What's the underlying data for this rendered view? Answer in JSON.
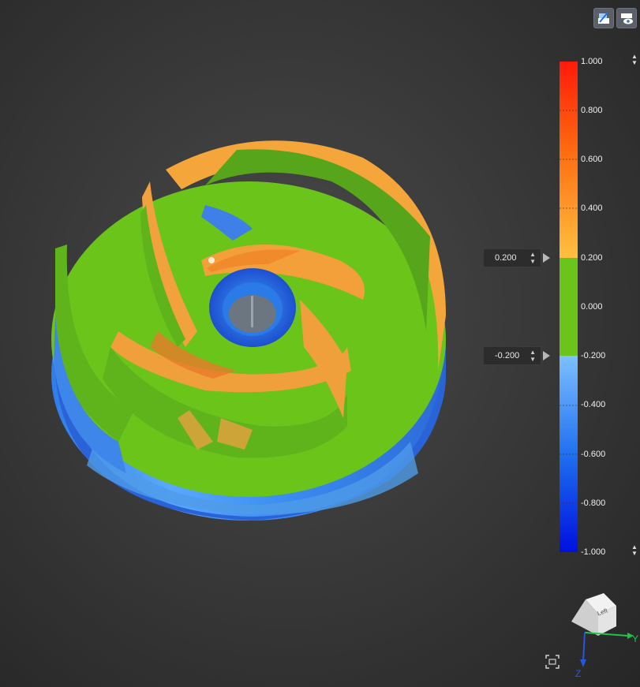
{
  "toolbar": {
    "buttons": [
      {
        "name": "section-view-button",
        "icon": "section-icon"
      },
      {
        "name": "visibility-button",
        "icon": "eye-icon"
      }
    ]
  },
  "colorbar": {
    "max": "1.000",
    "min": "-1.000",
    "ticks": [
      "1.000",
      "0.800",
      "0.600",
      "0.400",
      "0.200",
      "0.000",
      "-0.200",
      "-0.400",
      "-0.600",
      "-0.800",
      "-1.000"
    ],
    "colors": {
      "high": "#ff1a00",
      "upper": "#ffb030",
      "tolerance": "#6ac41a",
      "lower": "#5aa8ff",
      "low": "#0010e0"
    }
  },
  "thresholds": {
    "upper_value": "0.200",
    "lower_value": "-0.200"
  },
  "view_cube": {
    "face_label": "Left",
    "axes": {
      "y": "Y",
      "z": "Z"
    }
  },
  "icons": {
    "fit_view": "frame-icon"
  }
}
